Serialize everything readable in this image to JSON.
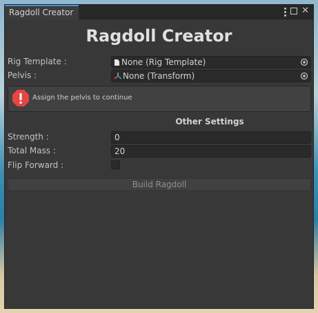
{
  "tab": {
    "label": "Ragdoll Creator"
  },
  "header": {
    "title": "Ragdoll Creator"
  },
  "fields": {
    "rig_template": {
      "label": "Rig Template :",
      "value": "None (Rig Template)",
      "icon": "document-icon"
    },
    "pelvis": {
      "label": "Pelvis :",
      "value": "None (Transform)",
      "icon": "transform-icon"
    }
  },
  "help": {
    "message": "Assign the pelvis to continue",
    "icon": "error-icon"
  },
  "other_settings": {
    "title": "Other Settings",
    "strength": {
      "label": "Strength :",
      "value": "0"
    },
    "total_mass": {
      "label": "Total Mass :",
      "value": "20"
    },
    "flip_forward": {
      "label": "Flip Forward :",
      "checked": false
    }
  },
  "actions": {
    "build_label": "Build Ragdoll"
  },
  "colors": {
    "tab_accent": "#4d8fd6",
    "error": "#e64545",
    "panel": "#383838"
  }
}
